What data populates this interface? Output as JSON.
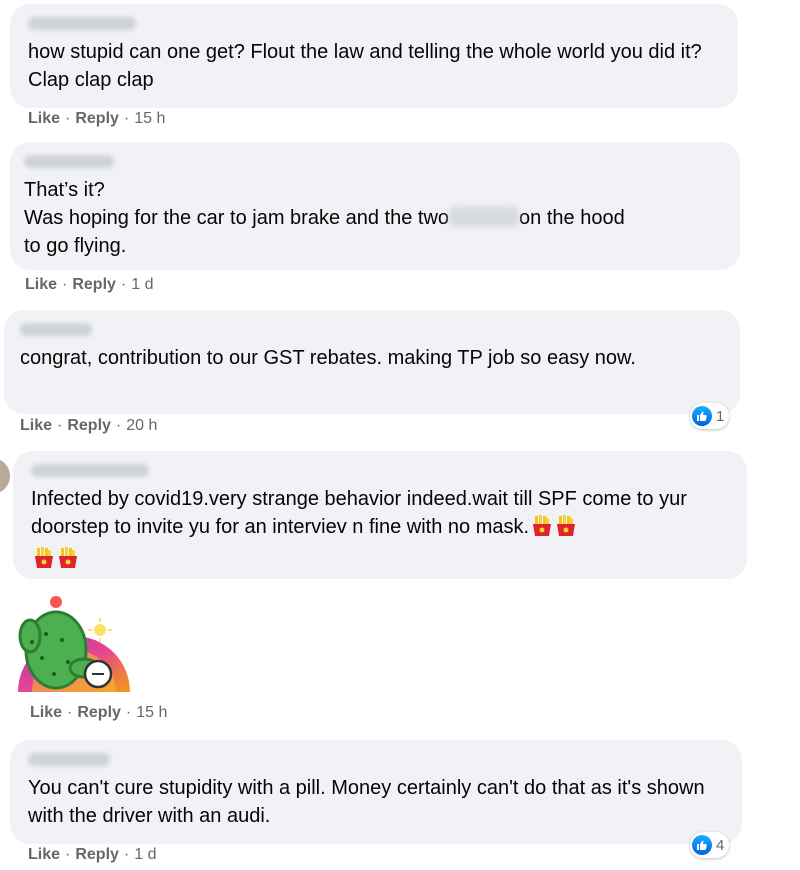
{
  "actions": {
    "like": "Like",
    "reply": "Reply",
    "dot": "·"
  },
  "comments": [
    {
      "text": "how stupid can one get? Flout the law and telling the whole world you did it? Clap clap clap",
      "time": "15 h"
    },
    {
      "line1": "That’s it?",
      "line2_before": "Was hoping for the car to jam brake and the two",
      "line2_after": "on the hood",
      "line3": "to go flying.",
      "time": "1 d"
    },
    {
      "text": "congrat, contribution to our GST rebates. making TP job so easy now.",
      "time": "20 h",
      "reaction_count": "1"
    },
    {
      "text": "Infected by covid19.very strange behavior indeed.wait till SPF come to yur doorstep to invite yu for an interviev n fine with no mask.",
      "emoji": "french-fries-emoji x4"
    },
    {
      "sticker": "cactus-sticker",
      "time": "15 h"
    },
    {
      "text": "You can't cure stupidity with a pill. Money certainly can't do that as it's shown with the driver with an audi.",
      "time": "1 d",
      "reaction_count": "4"
    }
  ],
  "colors": {
    "bubble": "#f0f2f5",
    "meta": "#65676b",
    "like_blue": "#1877f2"
  }
}
